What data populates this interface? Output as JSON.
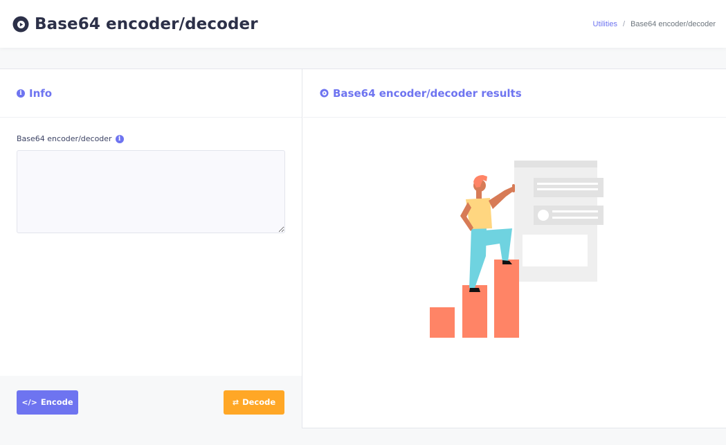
{
  "header": {
    "title": "Base64 encoder/decoder",
    "logo_icon": "play-circle-icon",
    "breadcrumb": {
      "link": "Utilities",
      "separator": "/",
      "current": "Base64 encoder/decoder"
    }
  },
  "left_panel": {
    "title": "Info",
    "title_icon": "info-icon",
    "field_label": "Base64 encoder/decoder",
    "field_value": "",
    "encode_label": "Encode",
    "encode_icon": "code-icon",
    "decode_label": "Decode",
    "decode_icon": "swap-arrows-icon"
  },
  "right_panel": {
    "title": "Base64 encoder/decoder results",
    "title_icon": "play-circle-icon",
    "illustration": "person-climbing-bar-chart"
  },
  "colors": {
    "accent": "#6e74f0",
    "encode_button": "#6e74f0",
    "decode_button": "#ffa726",
    "chart_bars": "#ff8466"
  }
}
